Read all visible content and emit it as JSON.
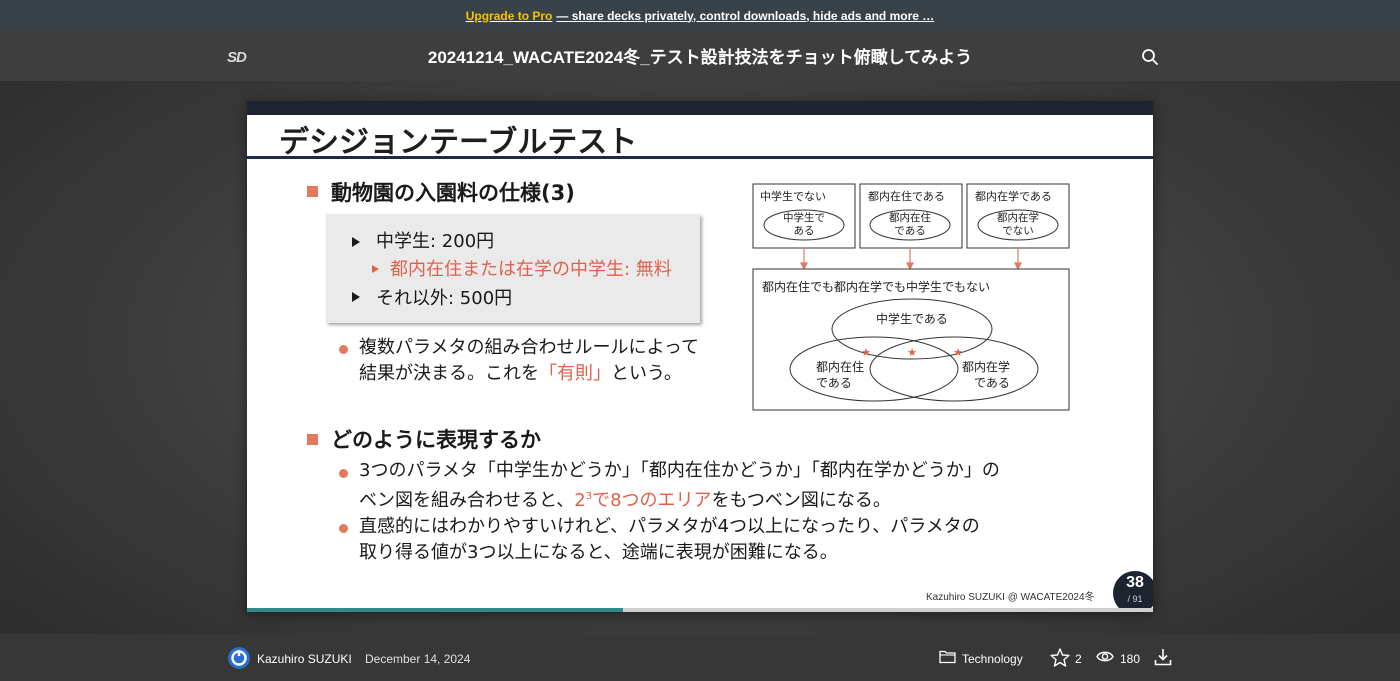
{
  "promo": {
    "upgrade_link": "Upgrade to Pro",
    "message": "— share decks privately, control downloads, hide ads and more …"
  },
  "header": {
    "logo_text": "SD",
    "deck_title": "20241214_WACATE2024冬_テスト設計技法をチョット俯瞰してみよう"
  },
  "slide": {
    "title": "デシジョンテーブルテスト",
    "section1": "動物園の入園料の仕様(3)",
    "spec": {
      "line1": "中学生: 200円",
      "line2": "都内在住または在学の中学生: 無料",
      "line3": "それ以外: 500円"
    },
    "bullet1": {
      "line1": "複数パラメタの組み合わせルールによって",
      "line2_pre": "結果が決まる。これを",
      "line2_hl": "「有則」",
      "line2_post": "という。"
    },
    "diagram": {
      "box1_title": "中学生でない",
      "box1_ellipse": [
        "中学生で",
        "ある"
      ],
      "box2_title": "都内在住である",
      "box2_ellipse": [
        "都内在住",
        "である"
      ],
      "box3_title": "都内在学である",
      "box3_ellipse": [
        "都内在学",
        "でない"
      ],
      "venn_title": "都内在住でも都内在学でも中学生でもない",
      "venn_top": "中学生である",
      "venn_left": [
        "都内在住",
        "である"
      ],
      "venn_right": [
        "都内在学",
        "である"
      ],
      "star": "★"
    },
    "section2": "どのように表現するか",
    "bullet2": {
      "line1": "3つのパラメタ「中学生かどうか」「都内在住かどうか」「都内在学かどうか」の",
      "line2_pre": "ベン図を組み合わせると、",
      "line2_hl_base": "2",
      "line2_hl_sup": "3",
      "line2_hl_post": "で8つのエリア",
      "line2_post": "をもつベン図になる。"
    },
    "bullet3": {
      "line1": "直感的にはわかりやすいけれど、パラメタが4つ以上になったり、パラメタの",
      "line2": "取り得る値が3つ以上になると、途端に表現が困難になる。"
    },
    "credit": "Kazuhiro SUZUKI @ WACATE2024冬",
    "page_number": "38",
    "page_total": "/ 91",
    "progress": 0.415
  },
  "footer": {
    "author": "Kazuhiro SUZUKI",
    "date": "December 14, 2024",
    "category": "Technology",
    "stars": "2",
    "views": "180"
  },
  "colors": {
    "accent_red": "#e0604a",
    "slide_navy": "#1e2330",
    "progress_teal": "#2f8a8a",
    "promo_yellow": "#f5c400"
  },
  "icons": [
    "speakerdeck-logo",
    "search-icon",
    "folder-icon",
    "star-icon",
    "eye-icon",
    "download-icon"
  ]
}
